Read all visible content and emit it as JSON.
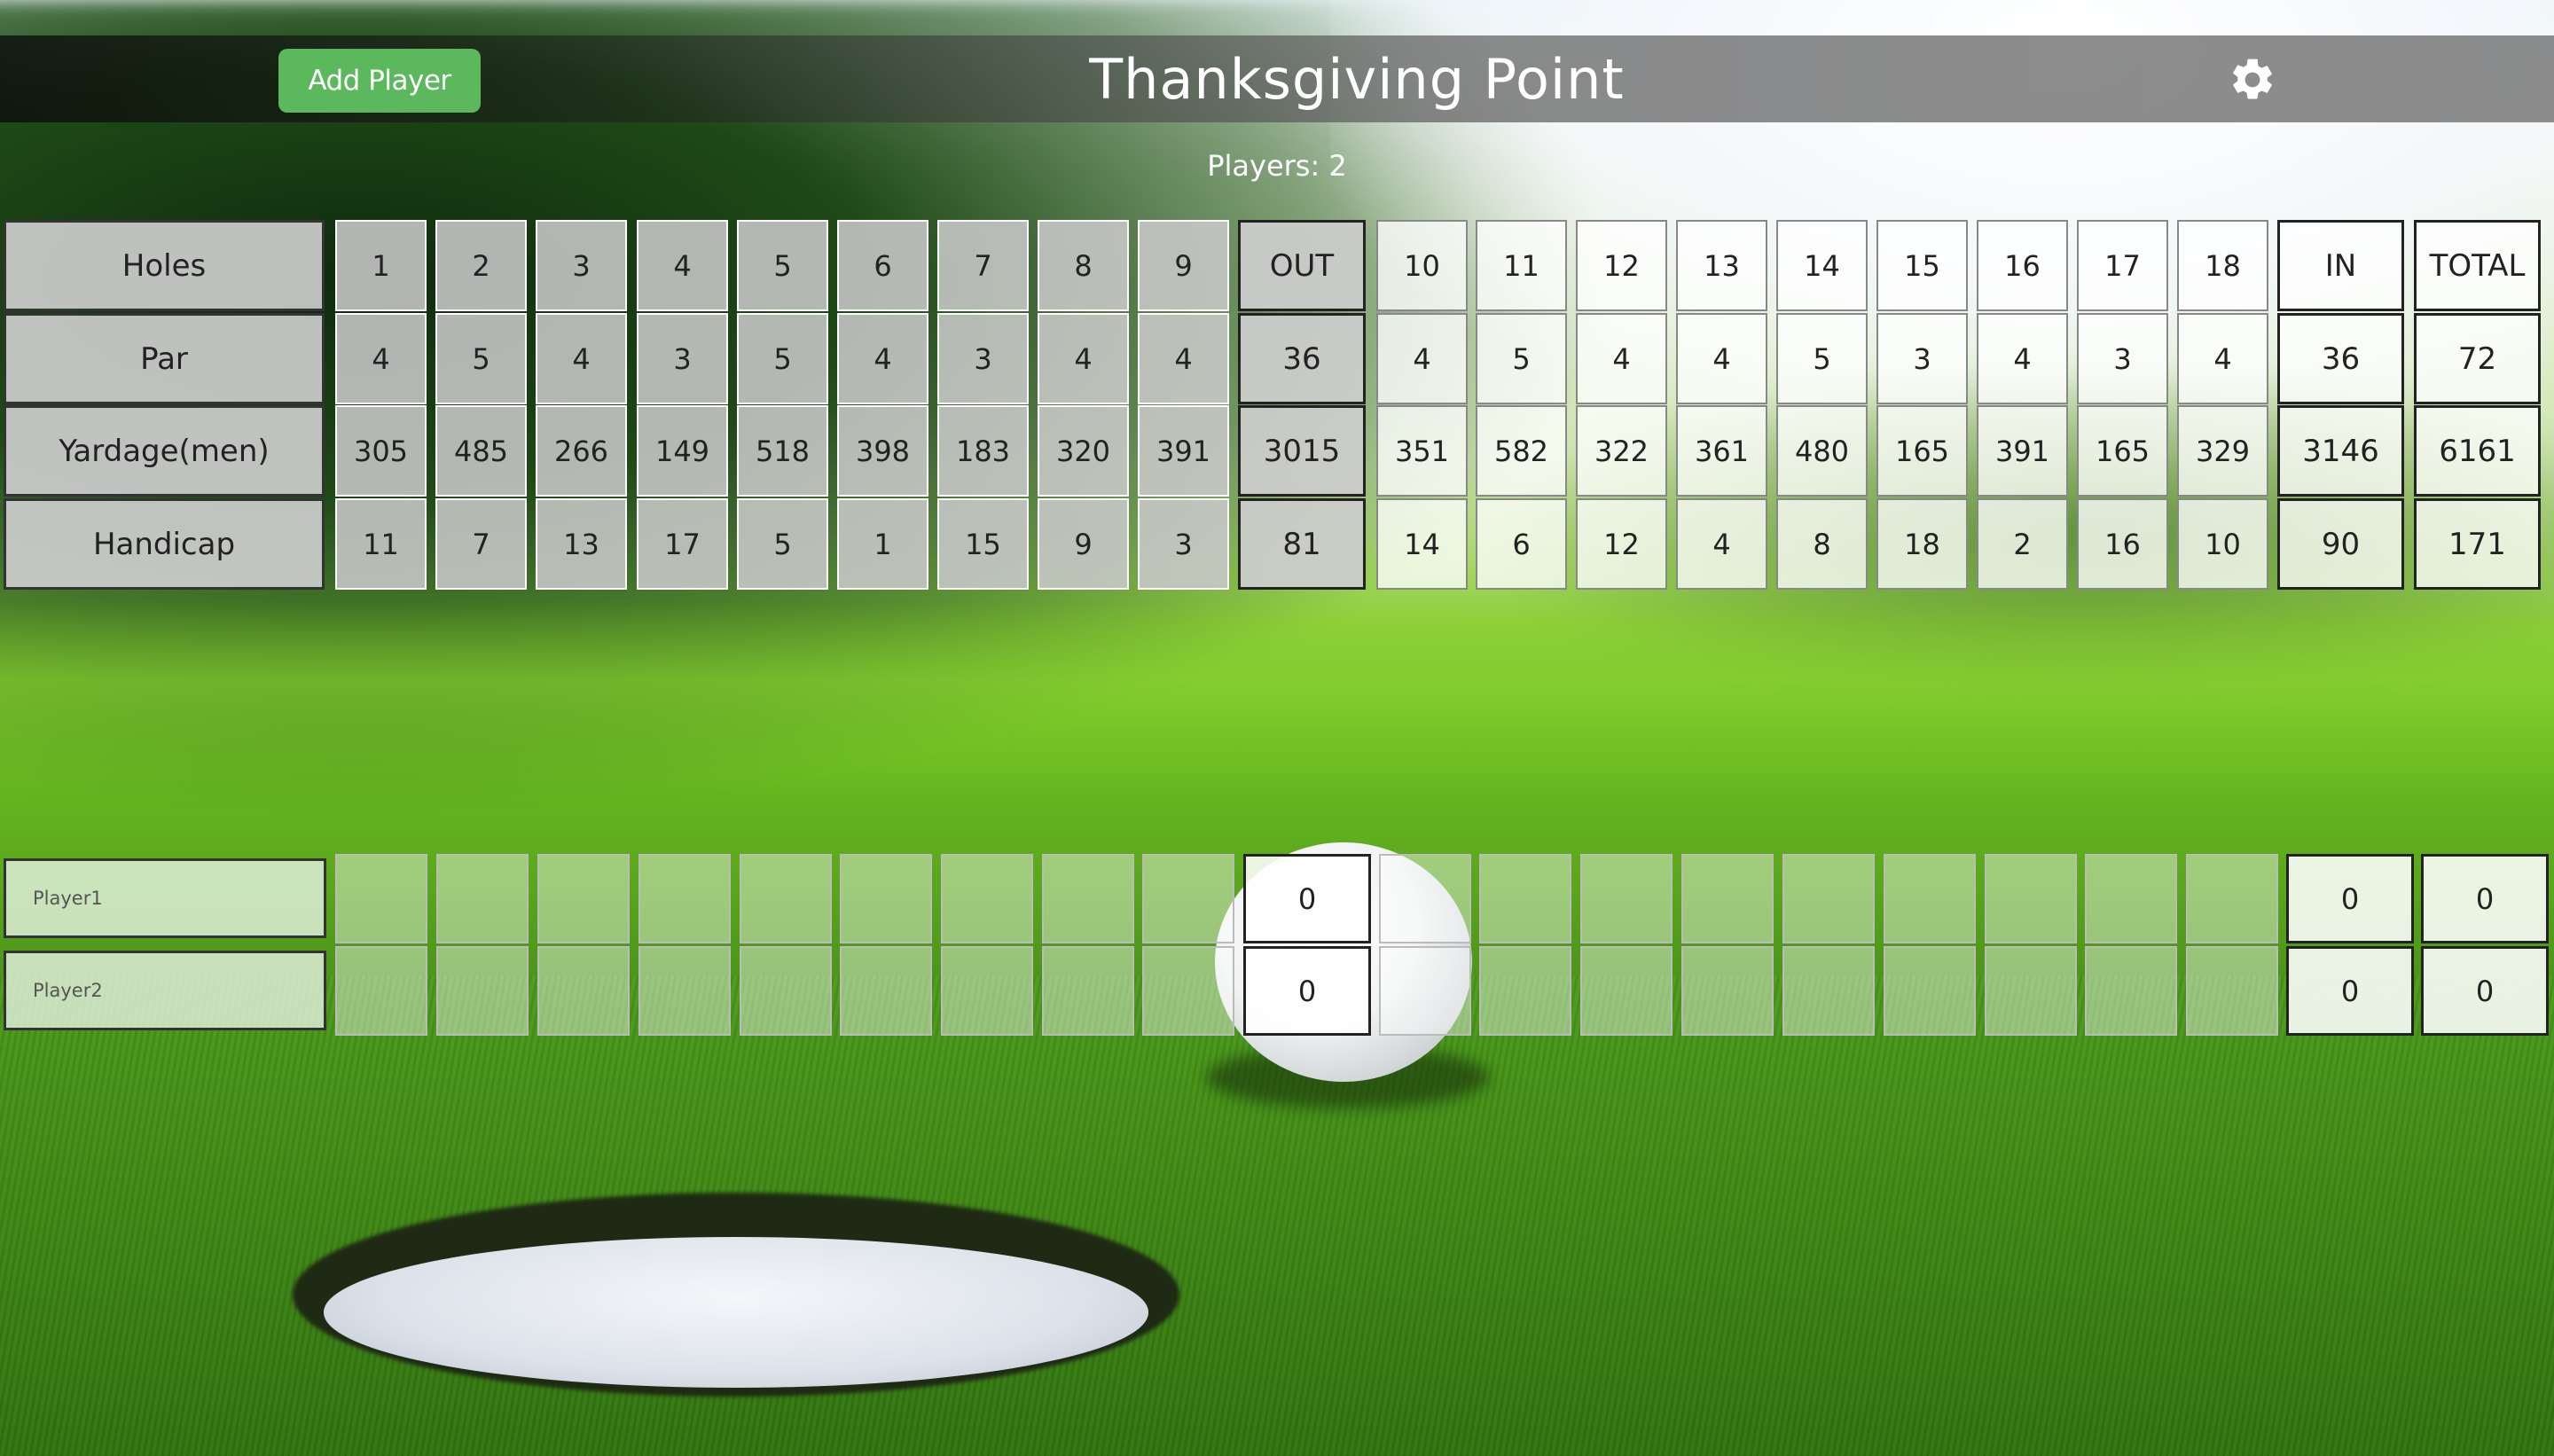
{
  "header": {
    "add_player_label": "Add Player",
    "title": "Thanksgiving Point",
    "settings_icon": "gear-icon"
  },
  "players_count": "Players: 2",
  "colors": {
    "add_player_bg": "#5cb85c",
    "title_text": "#ffffff"
  },
  "scorecard": {
    "row_labels": [
      "Holes",
      "Par",
      "Yardage(men)",
      "Handicap"
    ],
    "front_nine": [
      {
        "hole": "1",
        "par": "4",
        "yards": "305",
        "hcp": "11"
      },
      {
        "hole": "2",
        "par": "5",
        "yards": "485",
        "hcp": "7"
      },
      {
        "hole": "3",
        "par": "4",
        "yards": "266",
        "hcp": "13"
      },
      {
        "hole": "4",
        "par": "3",
        "yards": "149",
        "hcp": "17"
      },
      {
        "hole": "5",
        "par": "5",
        "yards": "518",
        "hcp": "5"
      },
      {
        "hole": "6",
        "par": "4",
        "yards": "398",
        "hcp": "1"
      },
      {
        "hole": "7",
        "par": "3",
        "yards": "183",
        "hcp": "15"
      },
      {
        "hole": "8",
        "par": "4",
        "yards": "320",
        "hcp": "9"
      },
      {
        "hole": "9",
        "par": "4",
        "yards": "391",
        "hcp": "3"
      }
    ],
    "out": {
      "label": "OUT",
      "par": "36",
      "yards": "3015",
      "hcp": "81"
    },
    "back_nine": [
      {
        "hole": "10",
        "par": "4",
        "yards": "351",
        "hcp": "14"
      },
      {
        "hole": "11",
        "par": "5",
        "yards": "582",
        "hcp": "6"
      },
      {
        "hole": "12",
        "par": "4",
        "yards": "322",
        "hcp": "12"
      },
      {
        "hole": "13",
        "par": "4",
        "yards": "361",
        "hcp": "4"
      },
      {
        "hole": "14",
        "par": "5",
        "yards": "480",
        "hcp": "8"
      },
      {
        "hole": "15",
        "par": "3",
        "yards": "165",
        "hcp": "18"
      },
      {
        "hole": "16",
        "par": "4",
        "yards": "391",
        "hcp": "2"
      },
      {
        "hole": "17",
        "par": "3",
        "yards": "165",
        "hcp": "16"
      },
      {
        "hole": "18",
        "par": "4",
        "yards": "329",
        "hcp": "10"
      }
    ],
    "in": {
      "label": "IN",
      "par": "36",
      "yards": "3146",
      "hcp": "90"
    },
    "total": {
      "label": "TOTAL",
      "par": "72",
      "yards": "6161",
      "hcp": "171"
    }
  },
  "players": [
    {
      "name": "Player1",
      "scores": [
        "",
        "",
        "",
        "",
        "",
        "",
        "",
        "",
        "",
        "",
        "",
        "",
        "",
        "",
        "",
        "",
        "",
        ""
      ],
      "out": "0",
      "in": "0",
      "total": "0"
    },
    {
      "name": "Player2",
      "scores": [
        "",
        "",
        "",
        "",
        "",
        "",
        "",
        "",
        "",
        "",
        "",
        "",
        "",
        "",
        "",
        "",
        "",
        ""
      ],
      "out": "0",
      "in": "0",
      "total": "0"
    }
  ]
}
